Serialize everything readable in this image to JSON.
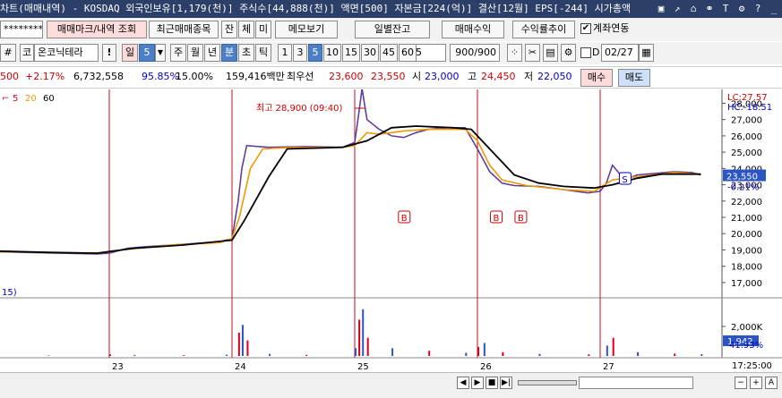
{
  "window": {
    "title": "차트(매매내역) - KOSDAQ 외국인보유[1,179(천)] 주식수[44,888(천)] 액면[500] 자본금[224(억)] 결산[12월] EPS[-244] 시가총액",
    "icons": [
      "window-tile-icon",
      "pin-icon",
      "lock-icon",
      "link-icon",
      "text-size-icon",
      "settings-icon",
      "help-icon",
      "minimize-icon"
    ],
    "icon_glyphs": [
      "▣",
      "↗",
      "⌂",
      "⚭",
      "T",
      "⚙",
      "?",
      "_"
    ]
  },
  "toolbar1": {
    "account_mask": "********",
    "trade_mark_btn": "매매마크/내역 조회",
    "recent_stocks_btn": "최근매매종목",
    "balance_short": "잔",
    "execution_short": "체",
    "pending_short": "미",
    "memo_btn": "메모보기",
    "daily_balance_btn": "일별잔고",
    "trade_profit_btn": "매매수익",
    "return_trend_btn": "수익률추이",
    "account_link_check": "✔",
    "account_link_label": "계좌연동"
  },
  "toolbar2": {
    "market_short": "코",
    "stock_name": "온코닉테라",
    "alert": "!",
    "period_day": "일",
    "period_num": "5",
    "periods": [
      "주",
      "월",
      "년",
      "분",
      "초",
      "틱"
    ],
    "selected_period": "분",
    "intervals": [
      "1",
      "3",
      "5",
      "10",
      "15",
      "30",
      "45",
      "60"
    ],
    "selected_interval": "5",
    "count_select": "5",
    "count": "900/900",
    "date_prefix": "D",
    "date": "02/27"
  },
  "quote": {
    "price_part": "500",
    "change_pct": "+2.17%",
    "volume": "6,732,558",
    "ratio": "95.85%",
    "ratio2": "15.00%",
    "amount": "159,416백만",
    "priority_label": "최우선",
    "ask": "23,600",
    "bid": "23,550",
    "open_label": "시",
    "open": "23,000",
    "high_label": "고",
    "high": "24,450",
    "low_label": "저",
    "low": "22,050",
    "buy_btn": "매수",
    "sell_btn": "매도"
  },
  "chart_data": {
    "type": "line",
    "ma_legend": [
      "5",
      "20",
      "60"
    ],
    "ma_colors": [
      "#d8001c",
      "#f39800",
      "#000000"
    ],
    "price_axis": [
      "28,000",
      "27,000",
      "26,000",
      "25,000",
      "24,000",
      "23,000",
      "22,000",
      "21,000",
      "20,000",
      "19,000",
      "18,000",
      "17,000"
    ],
    "price_range": [
      16500,
      28300
    ],
    "lc": "LC:27.57",
    "hc": "HC:-18.51",
    "current_price": "23,550",
    "current_change": "-0.21%",
    "max_annotation": "최고 28,900 (09:40)",
    "vol_axis": "2,000K",
    "vol_current": "1,942",
    "vol_pct": "41.93%",
    "x_labels": [
      "23",
      "24",
      "25",
      "26",
      "27"
    ],
    "time_label": "17:25:00",
    "left_marker": "15)",
    "trade_marks": [
      {
        "label": "B",
        "day": 25.4
      },
      {
        "label": "B",
        "day": 26.15
      },
      {
        "label": "B",
        "day": 26.35
      },
      {
        "label": "S",
        "day": 27.2
      }
    ],
    "price": [
      [
        22.0,
        18900
      ],
      [
        22.3,
        18850
      ],
      [
        22.6,
        18800
      ],
      [
        22.9,
        18750
      ],
      [
        23.0,
        18800
      ],
      [
        23.15,
        19100
      ],
      [
        23.3,
        19200
      ],
      [
        23.5,
        19300
      ],
      [
        23.7,
        19400
      ],
      [
        23.9,
        19500
      ],
      [
        24.0,
        19700
      ],
      [
        24.05,
        22000
      ],
      [
        24.08,
        24000
      ],
      [
        24.12,
        25400
      ],
      [
        24.3,
        25300
      ],
      [
        24.6,
        25350
      ],
      [
        24.9,
        25300
      ],
      [
        25.0,
        25600
      ],
      [
        25.03,
        27200
      ],
      [
        25.06,
        28900
      ],
      [
        25.1,
        27000
      ],
      [
        25.2,
        26400
      ],
      [
        25.3,
        26000
      ],
      [
        25.4,
        25900
      ],
      [
        25.5,
        26200
      ],
      [
        25.6,
        26400
      ],
      [
        25.75,
        26500
      ],
      [
        25.9,
        26500
      ],
      [
        26.0,
        25200
      ],
      [
        26.05,
        24500
      ],
      [
        26.1,
        23800
      ],
      [
        26.2,
        23100
      ],
      [
        26.3,
        22950
      ],
      [
        26.5,
        22900
      ],
      [
        26.7,
        22700
      ],
      [
        26.9,
        22500
      ],
      [
        27.0,
        22600
      ],
      [
        27.05,
        23100
      ],
      [
        27.1,
        24200
      ],
      [
        27.2,
        23300
      ],
      [
        27.3,
        23600
      ],
      [
        27.45,
        23700
      ],
      [
        27.6,
        23800
      ],
      [
        27.75,
        23750
      ],
      [
        27.82,
        23600
      ]
    ],
    "ma_mid": [
      [
        22.0,
        18900
      ],
      [
        22.5,
        18850
      ],
      [
        22.9,
        18800
      ],
      [
        23.1,
        19000
      ],
      [
        23.5,
        19300
      ],
      [
        23.9,
        19450
      ],
      [
        24.0,
        19700
      ],
      [
        24.06,
        21000
      ],
      [
        24.15,
        24000
      ],
      [
        24.25,
        25200
      ],
      [
        24.5,
        25300
      ],
      [
        24.9,
        25300
      ],
      [
        25.0,
        25400
      ],
      [
        25.1,
        26200
      ],
      [
        25.2,
        26100
      ],
      [
        25.4,
        26300
      ],
      [
        25.6,
        26400
      ],
      [
        25.9,
        26400
      ],
      [
        26.0,
        25700
      ],
      [
        26.1,
        24200
      ],
      [
        26.2,
        23300
      ],
      [
        26.4,
        22950
      ],
      [
        26.7,
        22700
      ],
      [
        26.95,
        22600
      ],
      [
        27.1,
        23300
      ],
      [
        27.3,
        23500
      ],
      [
        27.6,
        23750
      ],
      [
        27.82,
        23650
      ]
    ],
    "ma_long": [
      [
        22.0,
        18950
      ],
      [
        22.5,
        18850
      ],
      [
        22.9,
        18800
      ],
      [
        23.2,
        19100
      ],
      [
        23.6,
        19300
      ],
      [
        24.0,
        19600
      ],
      [
        24.1,
        20800
      ],
      [
        24.3,
        23500
      ],
      [
        24.45,
        25200
      ],
      [
        24.9,
        25300
      ],
      [
        25.1,
        25700
      ],
      [
        25.3,
        26500
      ],
      [
        25.5,
        26600
      ],
      [
        25.8,
        26500
      ],
      [
        25.95,
        26400
      ],
      [
        26.1,
        25200
      ],
      [
        26.3,
        23600
      ],
      [
        26.5,
        23100
      ],
      [
        26.7,
        22900
      ],
      [
        26.95,
        22800
      ],
      [
        27.1,
        23000
      ],
      [
        27.3,
        23400
      ],
      [
        27.5,
        23650
      ],
      [
        27.82,
        23650
      ]
    ],
    "volume": [
      [
        22.0,
        30
      ],
      [
        22.5,
        20
      ],
      [
        23.0,
        60
      ],
      [
        23.2,
        40
      ],
      [
        23.6,
        30
      ],
      [
        23.95,
        50
      ],
      [
        24.05,
        900
      ],
      [
        24.08,
        1200
      ],
      [
        24.12,
        600
      ],
      [
        24.3,
        80
      ],
      [
        24.6,
        40
      ],
      [
        25.0,
        300
      ],
      [
        25.03,
        1400
      ],
      [
        25.06,
        1800
      ],
      [
        25.1,
        700
      ],
      [
        25.3,
        300
      ],
      [
        25.6,
        200
      ],
      [
        25.9,
        120
      ],
      [
        26.0,
        350
      ],
      [
        26.05,
        500
      ],
      [
        26.2,
        150
      ],
      [
        26.5,
        80
      ],
      [
        26.9,
        60
      ],
      [
        27.05,
        400
      ],
      [
        27.1,
        700
      ],
      [
        27.3,
        150
      ],
      [
        27.6,
        90
      ],
      [
        27.82,
        70
      ]
    ]
  },
  "bottom": {
    "nav": [
      "◀",
      "▶",
      "■",
      "▶|"
    ],
    "zoom": [
      "−",
      "+",
      "A"
    ]
  }
}
